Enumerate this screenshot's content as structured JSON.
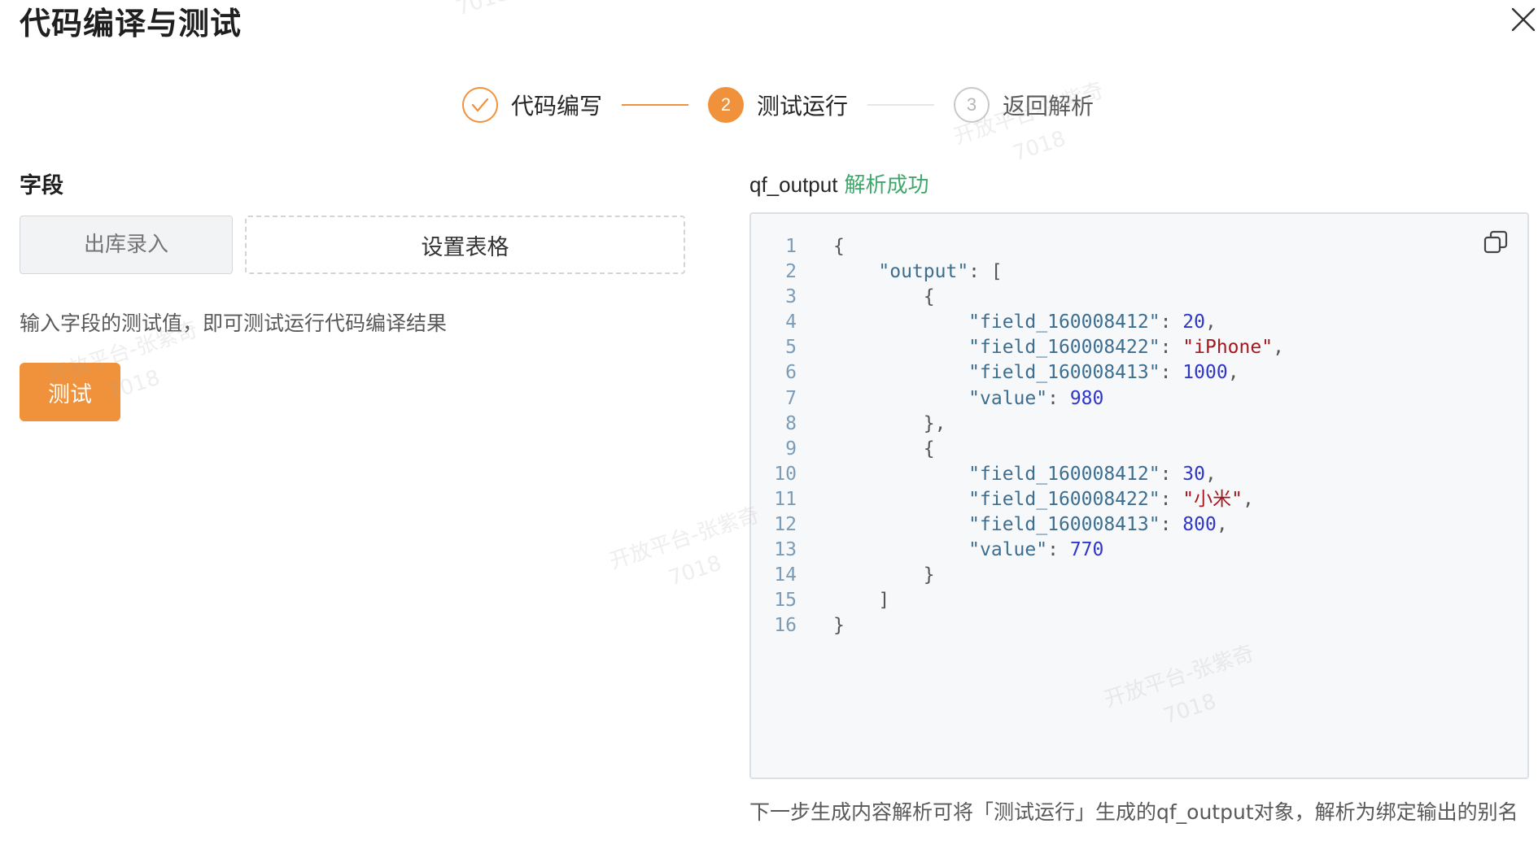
{
  "dialog": {
    "title": "代码编译与测试"
  },
  "steps": [
    {
      "label": "代码编写",
      "number": "1",
      "state": "done"
    },
    {
      "label": "测试运行",
      "number": "2",
      "state": "active"
    },
    {
      "label": "返回解析",
      "number": "3",
      "state": "todo"
    }
  ],
  "left": {
    "field_label": "字段",
    "field_input_placeholder": "出库录入",
    "set_table_label": "设置表格",
    "hint": "输入字段的测试值，即可测试运行代码编译结果",
    "test_button_label": "测试"
  },
  "output": {
    "name": "qf_output",
    "status": "解析成功",
    "code": [
      "{",
      "    \"output\": [",
      "        {",
      "            \"field_160008412\": 20,",
      "            \"field_160008422\": \"iPhone\",",
      "            \"field_160008413\": 1000,",
      "            \"value\": 980",
      "        },",
      "        {",
      "            \"field_160008412\": 30,",
      "            \"field_160008422\": \"小米\",",
      "            \"field_160008413\": 800,",
      "            \"value\": 770",
      "        }",
      "    ]",
      "}"
    ],
    "footer_note": "下一步生成内容解析可将「测试运行」生成的qf_output对象，解析为绑定输出的别名"
  },
  "watermark": {
    "line1": "开放平台-张紫奇",
    "line2": "7018"
  },
  "colors": {
    "accent": "#f0923b",
    "success": "#3ea76b",
    "code_key": "#3d6e90",
    "code_number": "#2f36c9",
    "code_string": "#a3181e"
  }
}
